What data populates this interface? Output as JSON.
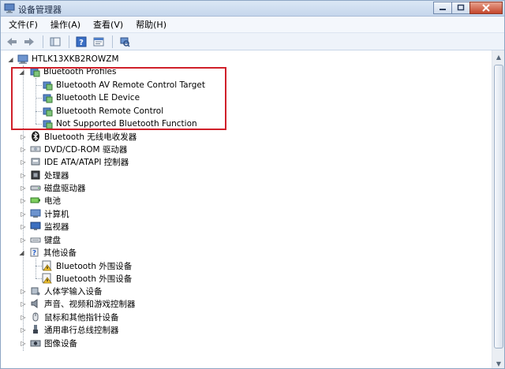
{
  "window": {
    "title": "设备管理器"
  },
  "menu": [
    "文件(F)",
    "操作(A)",
    "查看(V)",
    "帮助(H)"
  ],
  "toolbar": {
    "buttons": [
      "back-icon",
      "forward-icon",
      "properties-icon",
      "help-icon",
      "console-icon",
      "scan-hardware-icon"
    ]
  },
  "tree": {
    "root": "HTLK13XKB2ROWZM",
    "nodes": [
      {
        "label": "Bluetooth Profiles",
        "expanded": true,
        "icon": "bluetooth-profile-icon",
        "children": [
          "Bluetooth AV Remote Control Target",
          "Bluetooth LE Device",
          "Bluetooth Remote Control",
          "Not Supported Bluetooth Function"
        ]
      },
      {
        "label": "Bluetooth 无线电收发器",
        "expanded": false,
        "icon": "bluetooth-icon"
      },
      {
        "label": "DVD/CD-ROM 驱动器",
        "expanded": false,
        "icon": "dvd-drive-icon"
      },
      {
        "label": "IDE ATA/ATAPI 控制器",
        "expanded": false,
        "icon": "ide-controller-icon"
      },
      {
        "label": "处理器",
        "expanded": false,
        "icon": "processor-icon"
      },
      {
        "label": "磁盘驱动器",
        "expanded": false,
        "icon": "disk-drive-icon"
      },
      {
        "label": "电池",
        "expanded": false,
        "icon": "battery-icon"
      },
      {
        "label": "计算机",
        "expanded": false,
        "icon": "computer-icon"
      },
      {
        "label": "监视器",
        "expanded": false,
        "icon": "monitor-icon"
      },
      {
        "label": "键盘",
        "expanded": false,
        "icon": "keyboard-icon"
      },
      {
        "label": "其他设备",
        "expanded": true,
        "icon": "other-devices-icon",
        "children": [
          "Bluetooth 外围设备",
          "Bluetooth 外围设备"
        ]
      },
      {
        "label": "人体学输入设备",
        "expanded": false,
        "icon": "hid-icon"
      },
      {
        "label": "声音、视频和游戏控制器",
        "expanded": false,
        "icon": "sound-icon"
      },
      {
        "label": "鼠标和其他指针设备",
        "expanded": false,
        "icon": "mouse-icon"
      },
      {
        "label": "通用串行总线控制器",
        "expanded": false,
        "icon": "usb-icon"
      },
      {
        "label": "图像设备",
        "expanded": false,
        "icon": "imaging-icon"
      }
    ]
  },
  "colors": {
    "highlight": "#d0202a",
    "accent": "#2a62c9"
  }
}
